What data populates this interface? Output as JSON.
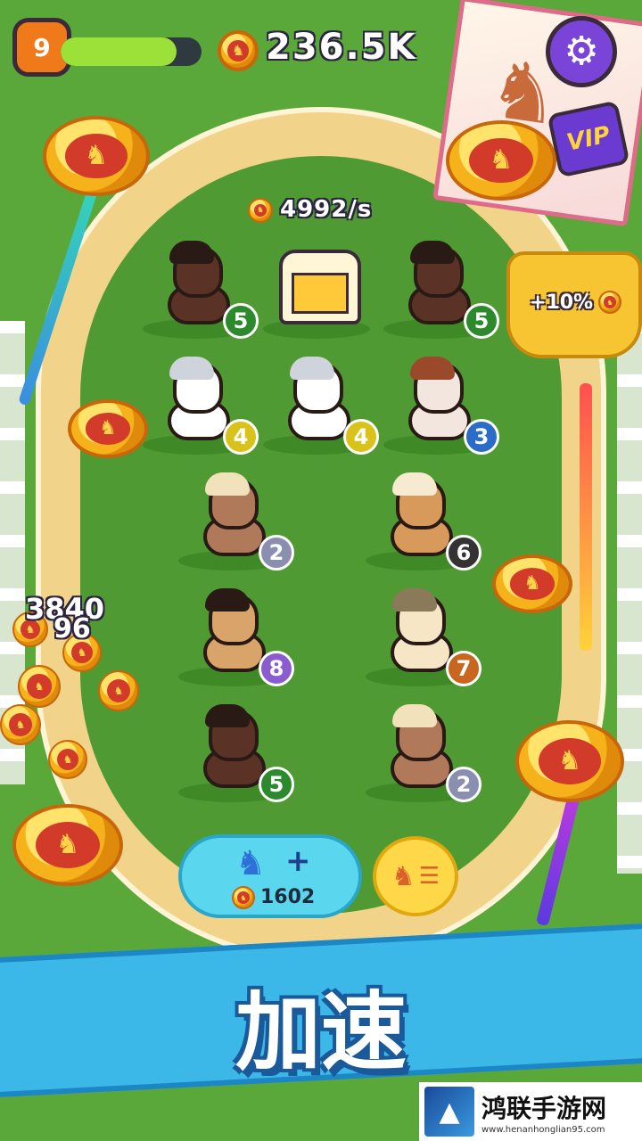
{
  "hud": {
    "level": "9",
    "progress": 0.82,
    "coins": "236.5K",
    "rate": "4992/s",
    "settings_icon": "gear-icon",
    "vip_label": "VIP"
  },
  "gate": {
    "bonus": "+10%"
  },
  "float_numbers": [
    "3840",
    "96"
  ],
  "slots": [
    {
      "coat": "dark-brown",
      "level": "5",
      "badge_color": "#2c8a2c"
    },
    {
      "coat": "trailer",
      "level": "",
      "badge_color": ""
    },
    {
      "coat": "dark-brown",
      "level": "5",
      "badge_color": "#2c8a2c"
    },
    {
      "coat": "white",
      "level": "4",
      "badge_color": "#d9c21a"
    },
    {
      "coat": "white",
      "level": "4",
      "badge_color": "#d9c21a"
    },
    {
      "coat": "pinto",
      "level": "3",
      "badge_color": "#2b6cc8"
    },
    {
      "coat": "palomino-brown",
      "level": "2",
      "badge_color": "#8a8fb0"
    },
    {
      "coat": "tan-blonde",
      "level": "6",
      "badge_color": "#333333"
    },
    {
      "coat": "buckskin",
      "level": "8",
      "badge_color": "#8a5ccf"
    },
    {
      "coat": "cream",
      "level": "7",
      "badge_color": "#c8661f"
    },
    {
      "coat": "dark-brown",
      "level": "5",
      "badge_color": "#2c8a2c"
    },
    {
      "coat": "palomino-brown",
      "level": "2",
      "badge_color": "#8a8fb0"
    }
  ],
  "buy_button": {
    "price": "1602",
    "plus": "+"
  },
  "banner": {
    "text": "加速"
  },
  "watermark": {
    "title": "鸿联手游网",
    "url": "www.henanhonglian95.com"
  },
  "colors": {
    "grass": "#5aa83a",
    "track": "#f2d38a",
    "banner": "#3bb7e8",
    "buy": "#5ad7ef",
    "coin": "#f6b21b"
  }
}
